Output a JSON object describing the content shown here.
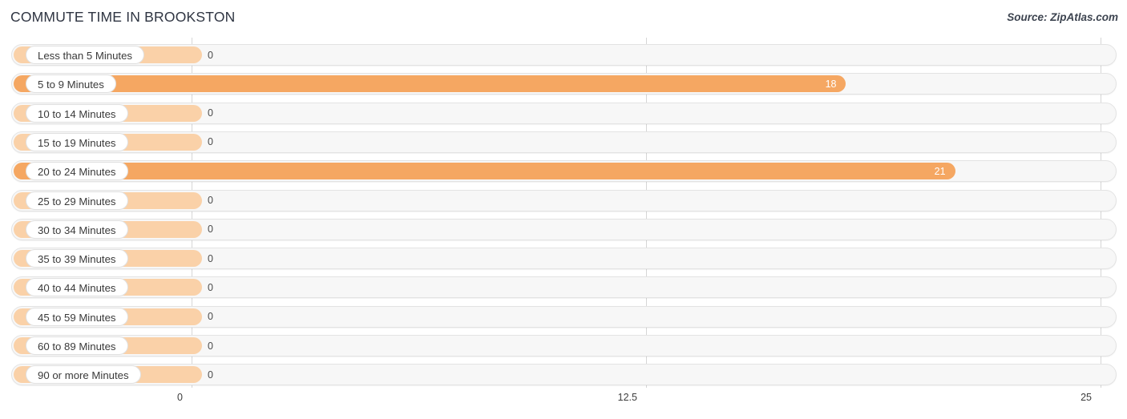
{
  "header": {
    "title": "COMMUTE TIME IN BROOKSTON",
    "source": "Source: ZipAtlas.com"
  },
  "colors": {
    "bar_value": "#f5a762",
    "bar_zero": "#fad1a8",
    "track": "#f7f7f7",
    "gridline": "#d6d6d6",
    "title": "#2f3542",
    "label_text": "#3a3a3a"
  },
  "chart_data": {
    "type": "bar",
    "orientation": "horizontal",
    "title": "COMMUTE TIME IN BROOKSTON",
    "xlabel": "",
    "ylabel": "",
    "xlim": [
      0,
      25
    ],
    "grid": true,
    "legend": false,
    "source": "Source: ZipAtlas.com",
    "axis_ticks": [
      "0",
      "12.5",
      "25"
    ],
    "axis_tick_values": [
      0,
      12.5,
      25
    ],
    "categories": [
      "Less than 5 Minutes",
      "5 to 9 Minutes",
      "10 to 14 Minutes",
      "15 to 19 Minutes",
      "20 to 24 Minutes",
      "25 to 29 Minutes",
      "30 to 34 Minutes",
      "35 to 39 Minutes",
      "40 to 44 Minutes",
      "45 to 59 Minutes",
      "60 to 89 Minutes",
      "90 or more Minutes"
    ],
    "values": [
      0,
      18,
      0,
      0,
      21,
      0,
      0,
      0,
      0,
      0,
      0,
      0
    ],
    "value_labels": [
      "0",
      "18",
      "0",
      "0",
      "21",
      "0",
      "0",
      "0",
      "0",
      "0",
      "0",
      "0"
    ]
  }
}
